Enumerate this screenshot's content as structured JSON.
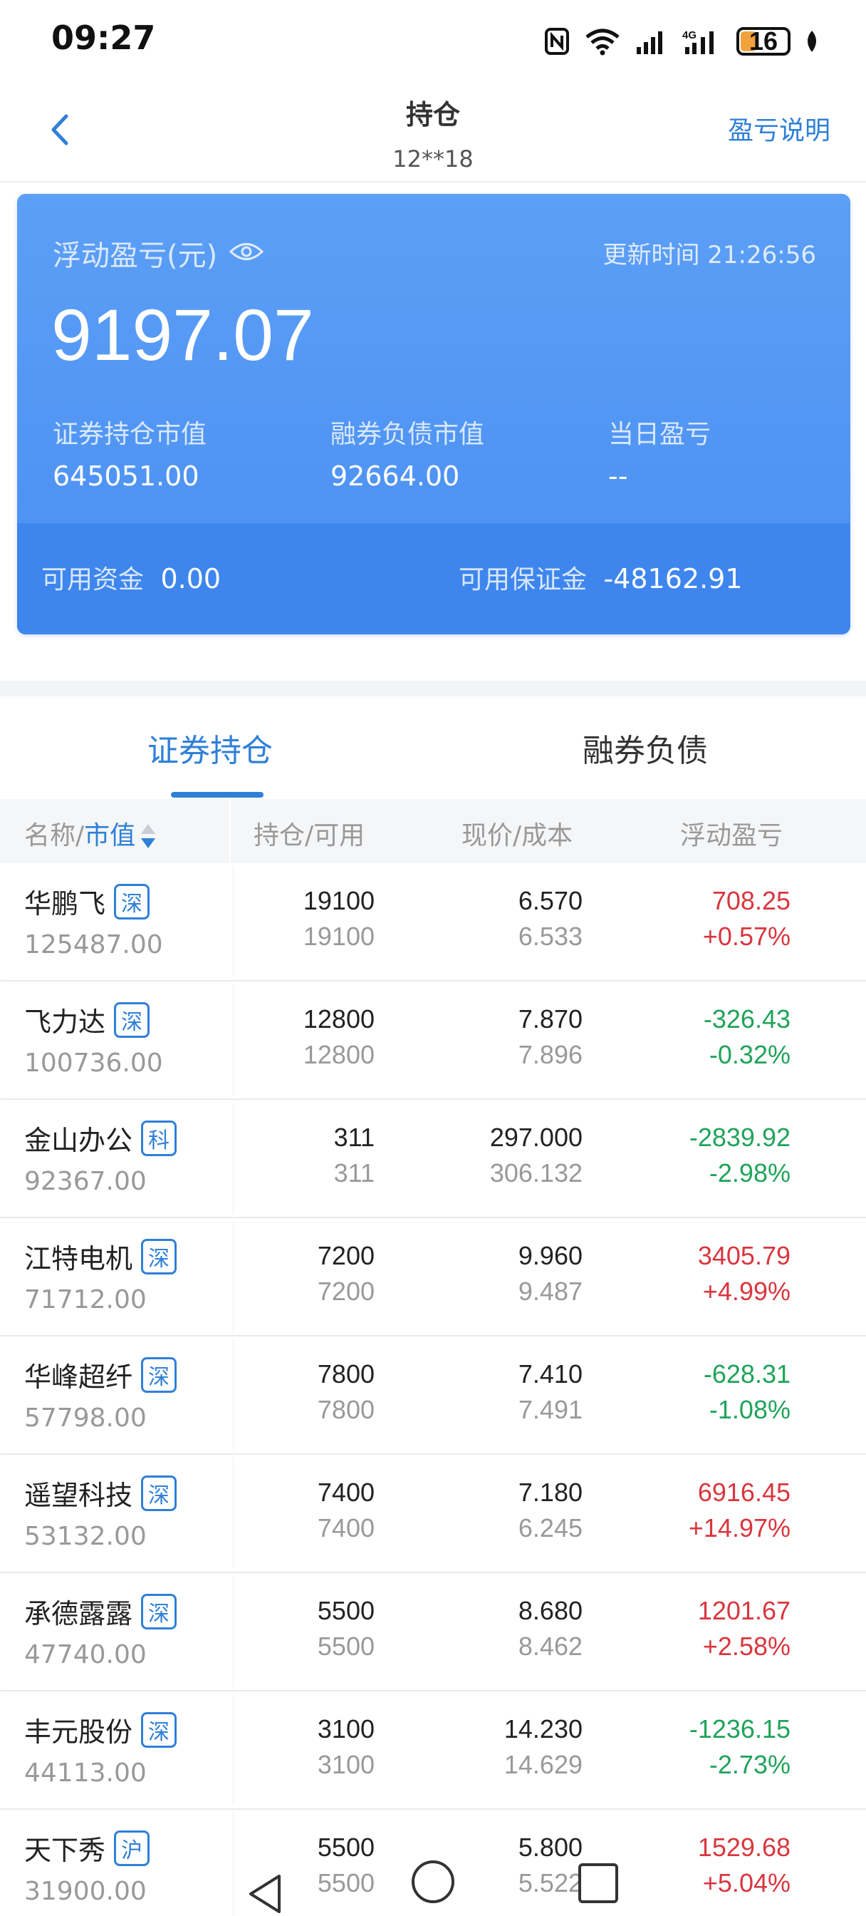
{
  "status_bar": {
    "time": "09:27",
    "battery": "16",
    "icons": [
      "nfc-icon",
      "wifi-icon",
      "signal-icon",
      "4g-signal-icon",
      "battery-icon",
      "leaf-icon"
    ]
  },
  "header": {
    "title": "持仓",
    "account": "12**18",
    "help_label": "盈亏说明"
  },
  "summary": {
    "float_pl_label": "浮动盈亏(元)",
    "update_label": "更新时间",
    "update_time": "21:26:56",
    "float_pl_value": "9197.07",
    "market_value_label": "证券持仓市值",
    "market_value": "645051.00",
    "short_liability_label": "融券负债市值",
    "short_liability": "92664.00",
    "daily_pl_label": "当日盈亏",
    "daily_pl": "--",
    "available_cash_label": "可用资金",
    "available_cash": "0.00",
    "available_margin_label": "可用保证金",
    "available_margin": "-48162.91"
  },
  "tabs": [
    {
      "label": "证券持仓",
      "active": true
    },
    {
      "label": "融券负债",
      "active": false
    }
  ],
  "table": {
    "col_name": "名称/",
    "col_name_sort": "市值",
    "col_position": "持仓/可用",
    "col_price": "现价/成本",
    "col_pl": "浮动盈亏",
    "rows": [
      {
        "name": "华鹏飞",
        "market": "深",
        "value": "125487.00",
        "hold": "19100",
        "avail": "19100",
        "price": "6.570",
        "cost": "6.533",
        "pl": "708.25",
        "pct": "+0.57%",
        "dir": "up"
      },
      {
        "name": "飞力达",
        "market": "深",
        "value": "100736.00",
        "hold": "12800",
        "avail": "12800",
        "price": "7.870",
        "cost": "7.896",
        "pl": "-326.43",
        "pct": "-0.32%",
        "dir": "down"
      },
      {
        "name": "金山办公",
        "market": "科",
        "value": "92367.00",
        "hold": "311",
        "avail": "311",
        "price": "297.000",
        "cost": "306.132",
        "pl": "-2839.92",
        "pct": "-2.98%",
        "dir": "down"
      },
      {
        "name": "江特电机",
        "market": "深",
        "value": "71712.00",
        "hold": "7200",
        "avail": "7200",
        "price": "9.960",
        "cost": "9.487",
        "pl": "3405.79",
        "pct": "+4.99%",
        "dir": "up"
      },
      {
        "name": "华峰超纤",
        "market": "深",
        "value": "57798.00",
        "hold": "7800",
        "avail": "7800",
        "price": "7.410",
        "cost": "7.491",
        "pl": "-628.31",
        "pct": "-1.08%",
        "dir": "down"
      },
      {
        "name": "遥望科技",
        "market": "深",
        "value": "53132.00",
        "hold": "7400",
        "avail": "7400",
        "price": "7.180",
        "cost": "6.245",
        "pl": "6916.45",
        "pct": "+14.97%",
        "dir": "up"
      },
      {
        "name": "承德露露",
        "market": "深",
        "value": "47740.00",
        "hold": "5500",
        "avail": "5500",
        "price": "8.680",
        "cost": "8.462",
        "pl": "1201.67",
        "pct": "+2.58%",
        "dir": "up"
      },
      {
        "name": "丰元股份",
        "market": "深",
        "value": "44113.00",
        "hold": "3100",
        "avail": "3100",
        "price": "14.230",
        "cost": "14.629",
        "pl": "-1236.15",
        "pct": "-2.73%",
        "dir": "down"
      },
      {
        "name": "天下秀",
        "market": "沪",
        "value": "31900.00",
        "hold": "5500",
        "avail": "5500",
        "price": "5.800",
        "cost": "5.522",
        "pl": "1529.68",
        "pct": "+5.04%",
        "dir": "up"
      }
    ]
  },
  "colors": {
    "accent": "#2f80d8",
    "card": "#4a8ff2",
    "up": "#d9363e",
    "down": "#1fa35a"
  }
}
